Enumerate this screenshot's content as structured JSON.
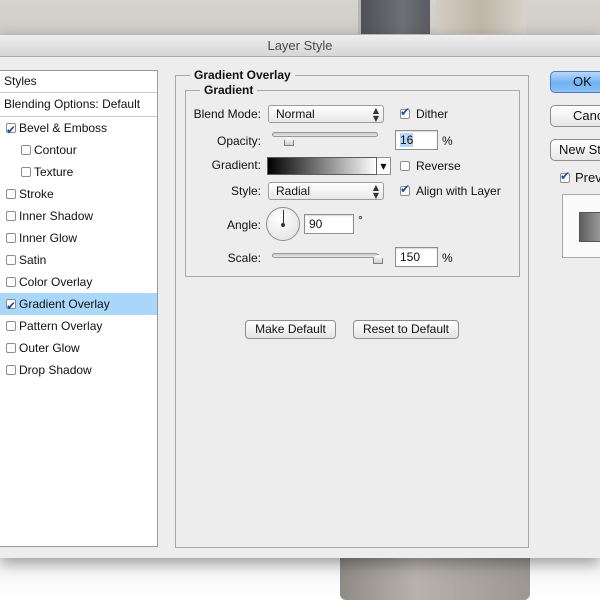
{
  "dialog": {
    "title": "Layer Style"
  },
  "styles_panel": {
    "header": "Styles",
    "blending_options": "Blending Options: Default",
    "items": [
      {
        "label": "Bevel & Emboss",
        "checked": true,
        "selected": false,
        "sub": false
      },
      {
        "label": "Contour",
        "checked": false,
        "selected": false,
        "sub": true
      },
      {
        "label": "Texture",
        "checked": false,
        "selected": false,
        "sub": true
      },
      {
        "label": "Stroke",
        "checked": false,
        "selected": false,
        "sub": false
      },
      {
        "label": "Inner Shadow",
        "checked": false,
        "selected": false,
        "sub": false
      },
      {
        "label": "Inner Glow",
        "checked": false,
        "selected": false,
        "sub": false
      },
      {
        "label": "Satin",
        "checked": false,
        "selected": false,
        "sub": false
      },
      {
        "label": "Color Overlay",
        "checked": false,
        "selected": false,
        "sub": false
      },
      {
        "label": "Gradient Overlay",
        "checked": true,
        "selected": true,
        "sub": false
      },
      {
        "label": "Pattern Overlay",
        "checked": false,
        "selected": false,
        "sub": false
      },
      {
        "label": "Outer Glow",
        "checked": false,
        "selected": false,
        "sub": false
      },
      {
        "label": "Drop Shadow",
        "checked": false,
        "selected": false,
        "sub": false
      }
    ]
  },
  "gradient_overlay": {
    "group_title": "Gradient Overlay",
    "subgroup_title": "Gradient",
    "blend_mode": {
      "label": "Blend Mode:",
      "value": "Normal"
    },
    "dither": {
      "label": "Dither",
      "checked": true
    },
    "opacity": {
      "label": "Opacity:",
      "value": "16",
      "unit": "%",
      "slider_fraction": 0.16
    },
    "gradient": {
      "label": "Gradient:",
      "from_color": "#000000",
      "to_color": "#ffffff"
    },
    "reverse": {
      "label": "Reverse",
      "checked": false
    },
    "style": {
      "label": "Style:",
      "value": "Radial"
    },
    "align_with_layer": {
      "label": "Align with Layer",
      "checked": true
    },
    "angle": {
      "label": "Angle:",
      "value": "90",
      "unit": "°"
    },
    "scale": {
      "label": "Scale:",
      "value": "150",
      "unit": "%",
      "slider_fraction": 1.0
    },
    "make_default": "Make Default",
    "reset_to_default": "Reset to Default"
  },
  "right_panel": {
    "ok": "OK",
    "cancel": "Cancel",
    "new_style": "New Style...",
    "preview": {
      "label": "Preview",
      "checked": true
    }
  },
  "colors": {
    "selection_highlight": "#a8d7f9",
    "primary_button": "#6fb1f3",
    "checkmark": "#1c4f97"
  }
}
